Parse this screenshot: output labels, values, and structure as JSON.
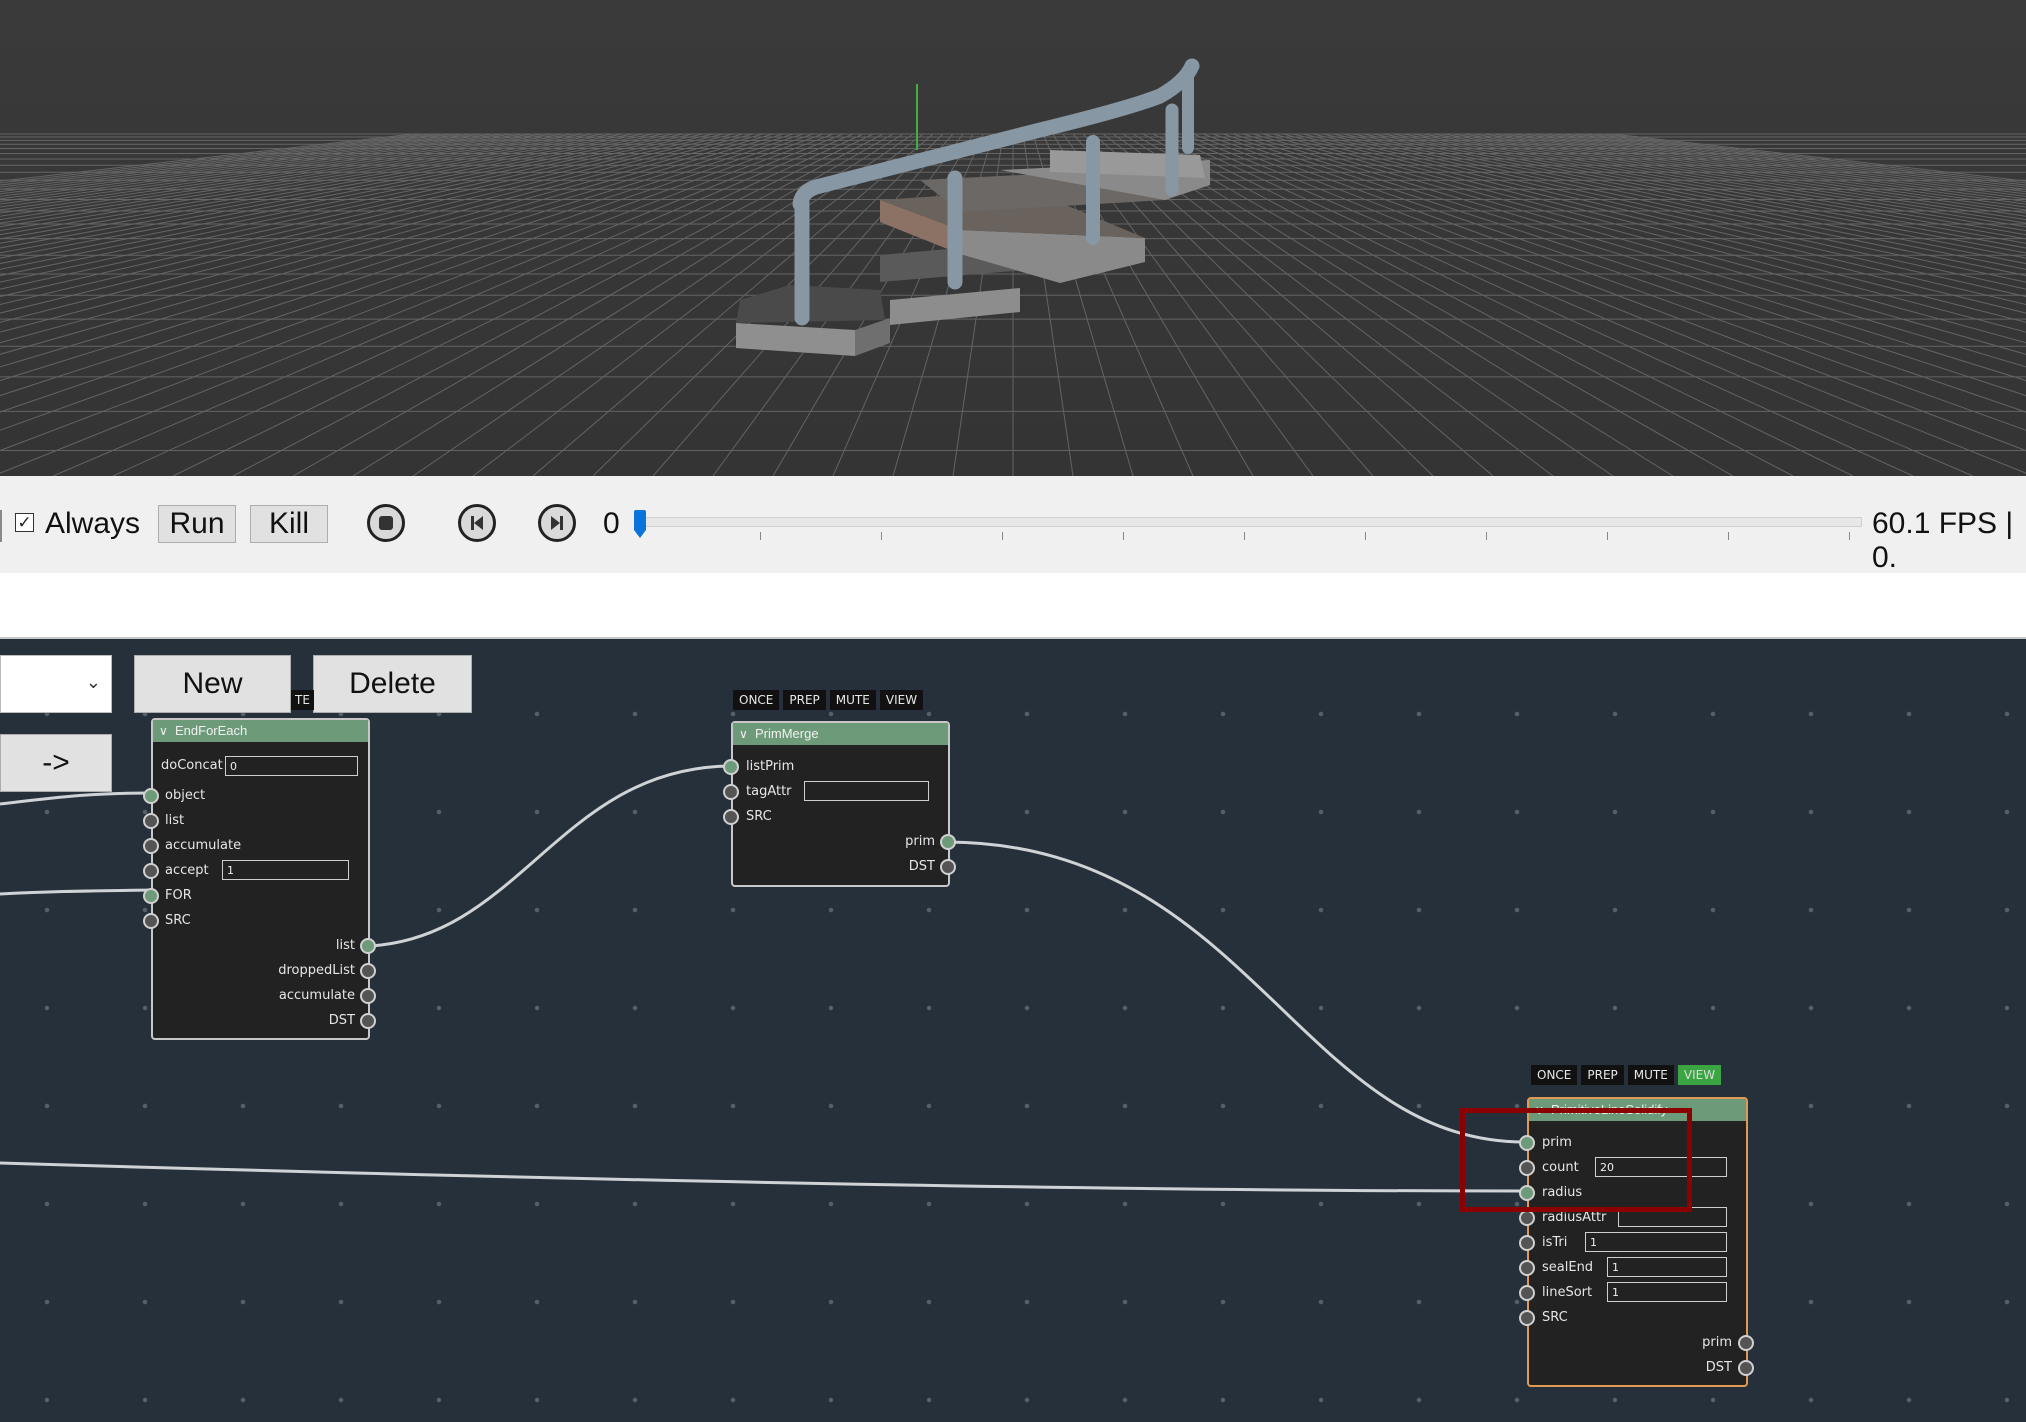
{
  "timeline": {
    "always_checked": true,
    "always_label": "Always",
    "run_label": "Run",
    "kill_label": "Kill",
    "frame_value": "0",
    "fps_text": "60.1 FPS | 0."
  },
  "editor": {
    "new_label": "New",
    "delete_label": "Delete",
    "arrow_label": "->",
    "clipped_flag": "TE"
  },
  "nodes": {
    "endforeach": {
      "title": "EndForEach",
      "inputs": [
        "doConcat",
        "object",
        "list",
        "accumulate",
        "accept",
        "FOR",
        "SRC"
      ],
      "doConcat_value": "0",
      "accept_value": "1",
      "outputs": [
        "list",
        "droppedList",
        "accumulate",
        "DST"
      ]
    },
    "primmerge": {
      "flags": [
        "ONCE",
        "PREP",
        "MUTE",
        "VIEW"
      ],
      "title": "PrimMerge",
      "inputs": [
        "listPrim",
        "tagAttr",
        "SRC"
      ],
      "tagAttr_value": "",
      "outputs": [
        "prim",
        "DST"
      ]
    },
    "linesolidify": {
      "flags": [
        "ONCE",
        "PREP",
        "MUTE",
        "VIEW"
      ],
      "view_active": true,
      "title": "PrimitiveLineSolidify",
      "inputs": [
        "prim",
        "count",
        "radius",
        "radiusAttr",
        "isTri",
        "sealEnd",
        "lineSort",
        "SRC"
      ],
      "count_value": "20",
      "radiusAttr_value": "",
      "isTri_value": "1",
      "sealEnd_value": "1",
      "lineSort_value": "1",
      "outputs": [
        "prim",
        "DST"
      ]
    }
  },
  "colors": {
    "viewport_bg": "#3b3b3b",
    "editor_bg": "#26303a",
    "node_header": "#6d9b7a",
    "selected_border": "#e09a55",
    "highlight": "#8b0000",
    "view_flag_on": "#3aa542"
  }
}
